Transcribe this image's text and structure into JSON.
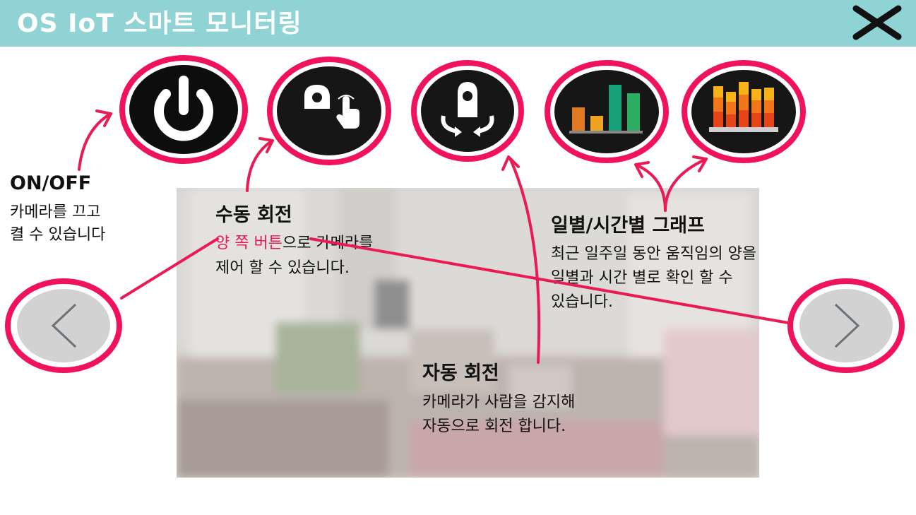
{
  "header": {
    "title": "OS IoT 스마트 모니터링",
    "background": "#8fd3d4"
  },
  "toolbar": {
    "buttons": [
      {
        "name": "power-button",
        "icon": "power-icon"
      },
      {
        "name": "manual-rotate-button",
        "icon": "camera-touch-icon"
      },
      {
        "name": "auto-rotate-button",
        "icon": "rotate-camera-icon"
      },
      {
        "name": "daily-graph-button",
        "icon": "bar-chart-icon"
      },
      {
        "name": "hourly-graph-button",
        "icon": "stacked-bar-chart-icon"
      }
    ],
    "ring_color": "#f0125a"
  },
  "nav": {
    "prev_icon": "chevron-left-icon",
    "next_icon": "chevron-right-icon"
  },
  "close_icon": "close-icon",
  "help": {
    "power": {
      "title": "ON/OFF",
      "line1": "카메라를 끄고",
      "line2": "켤 수 있습니다"
    },
    "manual": {
      "title": "수동 회전",
      "highlight": "양 쪽 버튼",
      "line1_rest": "으로 카메라를",
      "line2": "제어 할 수 있습니다."
    },
    "graph": {
      "title": "일별/시간별 그래프",
      "line1": "최근 일주일 동안 움직임의 양을",
      "line2": "일별과 시간 별로 확인 할 수",
      "line3": "있습니다."
    },
    "auto": {
      "title": "자동 회전",
      "line1": "카메라가 사람을 감지해",
      "line2": "자동으로 회전 합니다."
    }
  }
}
